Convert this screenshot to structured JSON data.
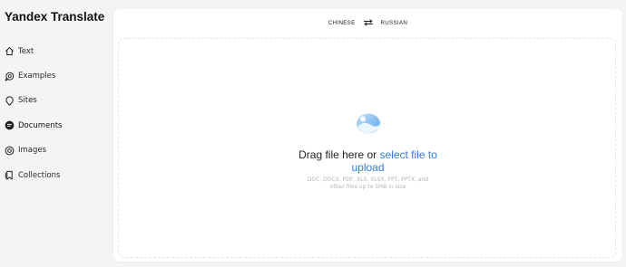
{
  "app": {
    "title": "Yandex Translate"
  },
  "sidebar": {
    "items": [
      {
        "label": "Text",
        "icon": "home-icon",
        "active": false
      },
      {
        "label": "Examples",
        "icon": "chat-bubbles-icon",
        "active": false
      },
      {
        "label": "Sites",
        "icon": "location-pin-icon",
        "active": false
      },
      {
        "label": "Documents",
        "icon": "document-icon",
        "active": true
      },
      {
        "label": "Images",
        "icon": "camera-icon",
        "active": false
      },
      {
        "label": "Collections",
        "icon": "bookmarks-icon",
        "active": false
      }
    ]
  },
  "languages": {
    "source": "CHINESE",
    "target": "RUSSIAN",
    "swap_icon": "swap-arrows-icon"
  },
  "upload": {
    "icon": "image-upload-icon",
    "title_prefix": "Drag file here or",
    "title_link_line1": "select file to",
    "title_link_line2": "upload",
    "hint_line1": "DOC, DOCX, PDF, XLS, XLSX, PPT, PPTX, and",
    "hint_line2": "other files up to 5MB in size"
  },
  "colors": {
    "accent": "#2f7de1",
    "background": "#f3f4f6",
    "card": "#ffffff",
    "hint_text": "#b3b6bc"
  }
}
